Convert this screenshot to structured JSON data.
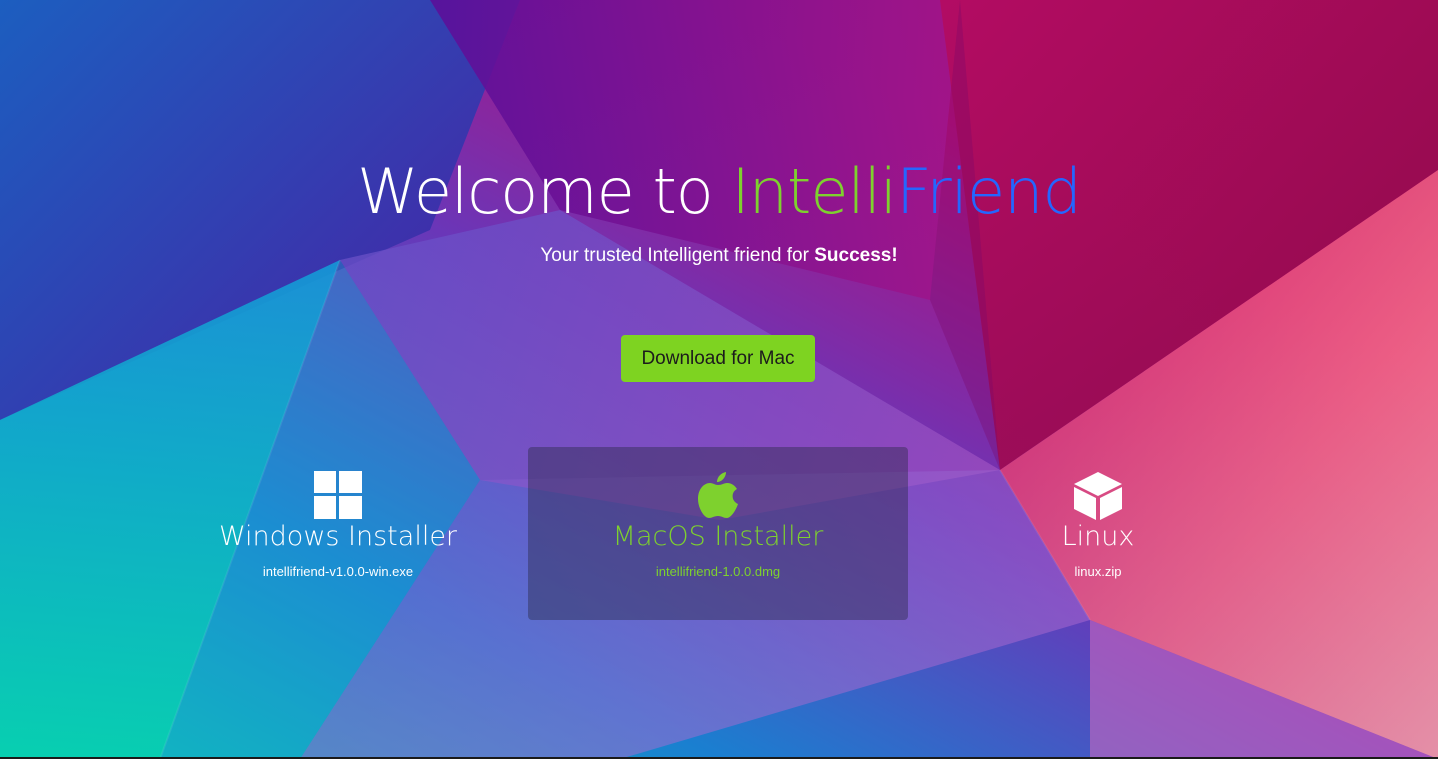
{
  "hero": {
    "title_part1": "Welcome to ",
    "title_part2": "Intelli",
    "title_part3": "Friend",
    "subtitle_text": "Your trusted Intelligent friend for ",
    "subtitle_bold": "Success!"
  },
  "download_button": {
    "label": "Download for Mac",
    "color": "#7ed321"
  },
  "installers": [
    {
      "name": "Windows Installer",
      "file": "intellifriend-v1.0.0-win.exe",
      "icon": "windows-logo-icon"
    },
    {
      "name": "MacOS Installer",
      "file": "intellifriend-1.0.0.dmg",
      "icon": "apple-logo-icon",
      "highlighted": true
    },
    {
      "name": "Linux",
      "file": "linux.zip",
      "icon": "cube-icon"
    }
  ],
  "colors": {
    "accent_green": "#7ed12e",
    "accent_blue": "#2466ff"
  }
}
